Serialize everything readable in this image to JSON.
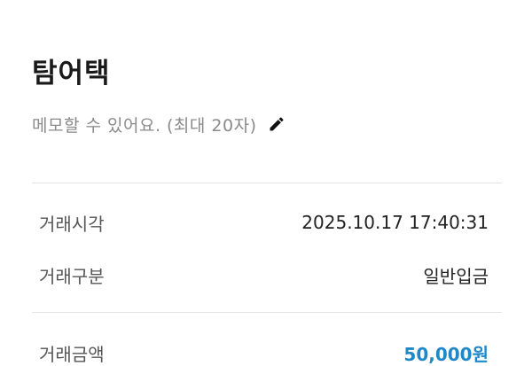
{
  "header": {
    "title": "탐어택",
    "memo_placeholder": "메모할 수 있어요. (최대 20자)",
    "edit_icon": "pencil-icon"
  },
  "details": {
    "time_label": "거래시각",
    "time_value": "2025.10.17 17:40:31",
    "type_label": "거래구분",
    "type_value": "일반입금",
    "amount_label": "거래금액",
    "amount_value": "50,000원"
  },
  "colors": {
    "amount": "#1e88c8",
    "divider": "#e3e3e3"
  }
}
